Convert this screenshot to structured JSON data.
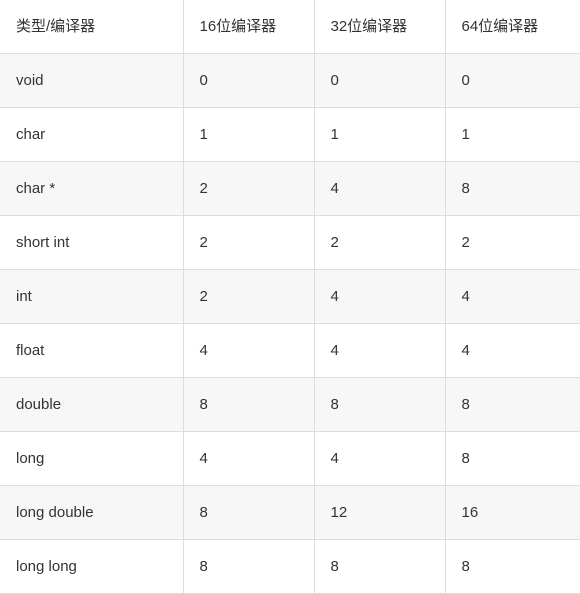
{
  "table": {
    "headers": [
      "类型/编译器",
      "16位编译器",
      "32位编译器",
      "64位编译器"
    ],
    "rows": [
      {
        "type": "void",
        "c16": "0",
        "c32": "0",
        "c64": "0"
      },
      {
        "type": "char",
        "c16": "1",
        "c32": "1",
        "c64": "1"
      },
      {
        "type": "char *",
        "c16": "2",
        "c32": "4",
        "c64": "8"
      },
      {
        "type": "short int",
        "c16": "2",
        "c32": "2",
        "c64": "2"
      },
      {
        "type": "int",
        "c16": "2",
        "c32": "4",
        "c64": "4"
      },
      {
        "type": "float",
        "c16": "4",
        "c32": "4",
        "c64": "4"
      },
      {
        "type": "double",
        "c16": "8",
        "c32": "8",
        "c64": "8"
      },
      {
        "type": "long",
        "c16": "4",
        "c32": "4",
        "c64": "8"
      },
      {
        "type": "long double",
        "c16": "8",
        "c32": "12",
        "c64": "16"
      },
      {
        "type": "long long",
        "c16": "8",
        "c32": "8",
        "c64": "8"
      }
    ],
    "colors": {
      "border": "#dddddd",
      "stripe": "#f7f7f7",
      "background": "#ffffff",
      "text": "#333333"
    }
  }
}
